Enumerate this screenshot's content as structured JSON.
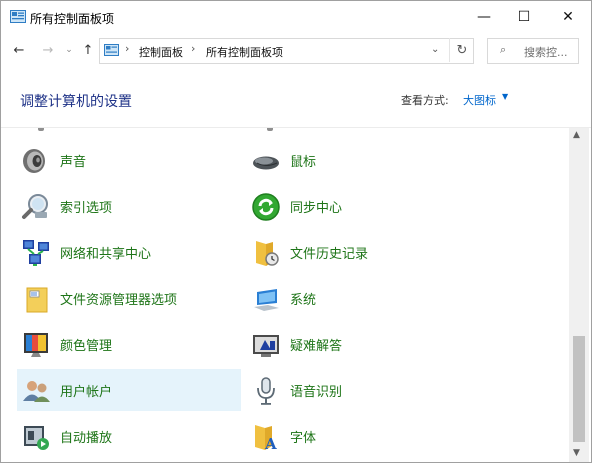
{
  "window": {
    "title": "所有控制面板项",
    "minimize": "—",
    "maximize": "☐",
    "close": "✕"
  },
  "nav": {
    "back": "←",
    "forward": "→",
    "recent": "⌄",
    "up": "↑",
    "separator": "›",
    "breadcrumbs": [
      "控制面板",
      "所有控制面板项"
    ],
    "dropdown": "⌄",
    "refresh": "↻",
    "search_icon": "⌕",
    "search_placeholder": "搜索控..."
  },
  "header": {
    "title": "调整计算机的设置",
    "view_by_label": "查看方式:",
    "view_by_value": "大图标",
    "view_by_caret": "▼"
  },
  "items": [
    {
      "label": "声音",
      "icon": "speaker-icon"
    },
    {
      "label": "鼠标",
      "icon": "mouse-icon"
    },
    {
      "label": "索引选项",
      "icon": "indexing-icon"
    },
    {
      "label": "同步中心",
      "icon": "sync-icon"
    },
    {
      "label": "网络和共享中心",
      "icon": "network-icon"
    },
    {
      "label": "文件历史记录",
      "icon": "file-history-icon"
    },
    {
      "label": "文件资源管理器选项",
      "icon": "folder-options-icon"
    },
    {
      "label": "系统",
      "icon": "system-icon"
    },
    {
      "label": "颜色管理",
      "icon": "color-management-icon"
    },
    {
      "label": "疑难解答",
      "icon": "troubleshooting-icon"
    },
    {
      "label": "用户帐户",
      "icon": "user-accounts-icon"
    },
    {
      "label": "语音识别",
      "icon": "microphone-icon"
    },
    {
      "label": "自动播放",
      "icon": "autoplay-icon"
    },
    {
      "label": "字体",
      "icon": "fonts-icon"
    }
  ],
  "scrollbar": {
    "up": "▲",
    "down": "▼"
  },
  "colors": {
    "link_green": "#1d7417",
    "title_blue": "#1e3287",
    "hover_bg": "#e5f3fb",
    "view_link": "#0066cc"
  }
}
